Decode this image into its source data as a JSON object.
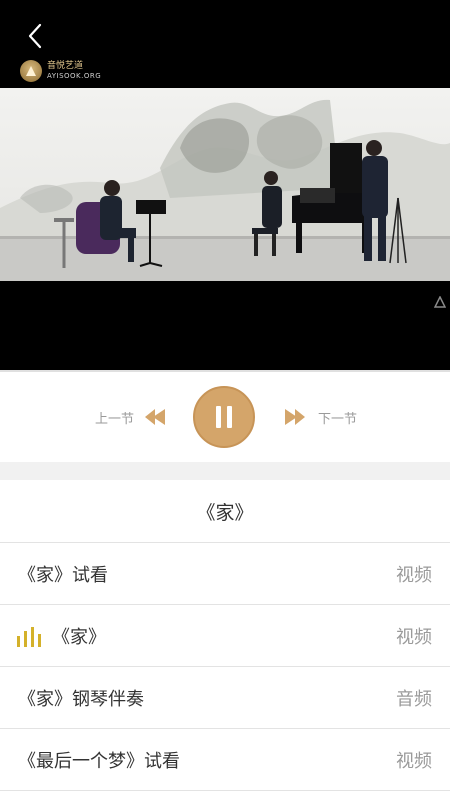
{
  "header": {
    "back_icon": "chevron-left-icon",
    "logo_cn": "音悦艺道",
    "logo_en": "AYISOOK.ORG"
  },
  "player": {
    "prev_label": "上一节",
    "next_label": "下一节",
    "state": "playing",
    "accent_color": "#d4a56a"
  },
  "lesson": {
    "title": "《家》"
  },
  "items": [
    {
      "title": "《家》试看",
      "type": "视频",
      "active": false
    },
    {
      "title": "《家》",
      "type": "视频",
      "active": true
    },
    {
      "title": "《家》钢琴伴奏",
      "type": "音频",
      "active": false
    },
    {
      "title": "《最后一个梦》试看",
      "type": "视频",
      "active": false
    }
  ]
}
